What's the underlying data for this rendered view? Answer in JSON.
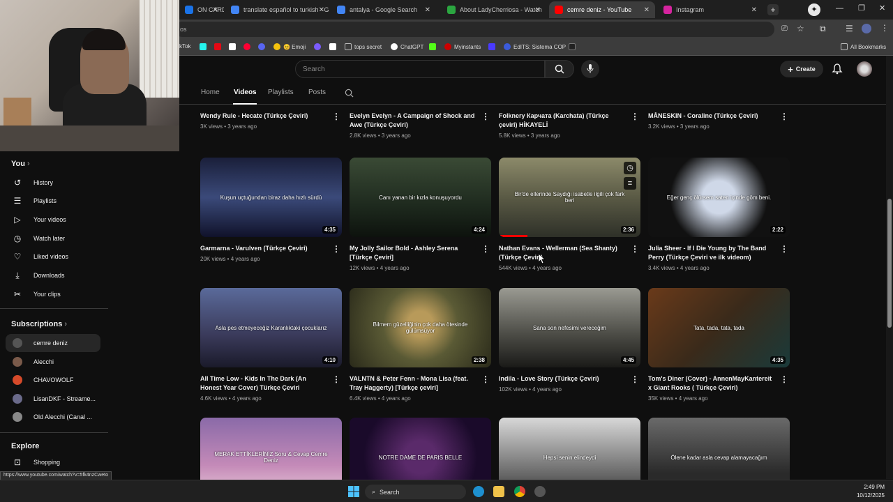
{
  "browser": {
    "tabs": [
      {
        "label": "ON CARD",
        "color": "#1a73e8"
      },
      {
        "label": "translate español to turkish - G",
        "color": "#4285f4"
      },
      {
        "label": "antalya - Google Search",
        "color": "#4285f4"
      },
      {
        "label": "About LadyCherriosa - Watch",
        "color": "#2ba640"
      },
      {
        "label": "cemre deniz - YouTube",
        "color": "#ff0000"
      },
      {
        "label": "Instagram",
        "color": "#d6249f"
      }
    ],
    "omnibox_text": "os",
    "bookmarks": [
      {
        "label": "kTok",
        "color": "#25f4ee"
      },
      {
        "label": "",
        "color": "#e50914"
      },
      {
        "label": "",
        "color": "#ffffff"
      },
      {
        "label": "",
        "color": "#ff0033"
      },
      {
        "label": "",
        "color": "#5865f2"
      },
      {
        "label": "😊 Emoji",
        "color": "#f4c20d"
      },
      {
        "label": "",
        "color": "#7b5cff"
      },
      {
        "label": "",
        "color": "#ffffff"
      },
      {
        "label": "tops secret",
        "color": "#bbbbbb"
      },
      {
        "label": "ChatGPT",
        "color": "#ffffff"
      },
      {
        "label": "",
        "color": "#53fc18"
      },
      {
        "label": "Myinstants",
        "color": "#cc0000"
      },
      {
        "label": "",
        "color": "#4a3aff"
      },
      {
        "label": "EdITS: Sistema COP",
        "color": "#3b5bdb"
      },
      {
        "label": "",
        "color": "#222222"
      }
    ],
    "all_bookmarks": "All Bookmarks",
    "status_url": "https://www.youtube.com/watch?v=5fk4nzCweto"
  },
  "header": {
    "search_placeholder": "Search",
    "create_label": "Create"
  },
  "channel_tabs": [
    "Home",
    "Videos",
    "Playlists",
    "Posts"
  ],
  "sidebar": {
    "you_label": "You",
    "you_items": [
      {
        "label": "History",
        "icon": "history-icon",
        "glyph": "↺"
      },
      {
        "label": "Playlists",
        "icon": "playlists-icon",
        "glyph": "☰"
      },
      {
        "label": "Your videos",
        "icon": "your-videos-icon",
        "glyph": "▶"
      },
      {
        "label": "Watch later",
        "icon": "watch-later-icon",
        "glyph": "◷"
      },
      {
        "label": "Liked videos",
        "icon": "thumbs-up-icon",
        "glyph": "👍"
      },
      {
        "label": "Downloads",
        "icon": "download-icon",
        "glyph": "⤓"
      },
      {
        "label": "Your clips",
        "icon": "scissors-icon",
        "glyph": "✂"
      }
    ],
    "subs_label": "Subscriptions",
    "subscriptions": [
      {
        "label": "cemre deniz",
        "color": "#555555"
      },
      {
        "label": "Alecchi",
        "color": "#7a5a4a"
      },
      {
        "label": "CHAVOWOLF",
        "color": "#d64a2a"
      },
      {
        "label": "LisanDKF - Streame...",
        "color": "#6a6a8a"
      },
      {
        "label": "Old Alecchi (Canal ...",
        "color": "#888888"
      }
    ],
    "explore_label": "Explore",
    "explore_items": [
      {
        "label": "Shopping",
        "icon": "shopping-bag-icon",
        "glyph": "🛍"
      }
    ]
  },
  "videos": [
    {
      "title": "Wendy Rule - Hecate (Türkçe Çeviri)",
      "meta": "3K views • 3 years ago",
      "duration": "",
      "overlay": "",
      "bg": "#222"
    },
    {
      "title": "Evelyn Evelyn - A Campaign of Shock and Awe (Türkçe Çeviri)",
      "meta": "2.8K views • 3 years ago",
      "duration": "",
      "overlay": "",
      "bg": "#222"
    },
    {
      "title": "Folknery Карчата (Karchata) (Türkçe çeviri) HİKAYELİ",
      "meta": "5.8K views • 3 years ago",
      "duration": "",
      "overlay": "",
      "bg": "#222"
    },
    {
      "title": "MÅNESKIN - Coraline (Türkçe Çeviri)",
      "meta": "3.2K views • 3 years ago",
      "duration": "",
      "overlay": "",
      "bg": "#222"
    },
    {
      "title": "Garmarna - Varulven (Türkçe Çeviri)",
      "meta": "20K views • 4 years ago",
      "duration": "4:35",
      "overlay": "Kuşun uçtuğundan biraz daha hızlı sürdü",
      "bg": "linear-gradient(180deg,#1a1f3a,#3b4a7a 50%,#10122a)"
    },
    {
      "title": "My Jolly Sailor Bold - Ashley Serena [Türkçe Çeviri]",
      "meta": "12K views • 4 years ago",
      "duration": "4:24",
      "overlay": "Canı yanan bir kızla konuşuyordu",
      "bg": "linear-gradient(180deg,#3a4a35,#1e2a1e 60%,#0d120d)"
    },
    {
      "title": "Nathan Evans - Wellerman (Sea Shanty) (Türkçe Çeviri)",
      "meta": "544K views • 4 years ago",
      "duration": "2:36",
      "overlay": "Bir'de ellerinde Saydığı isabetle ilgili çok fark beri",
      "bg": "linear-gradient(180deg,#8c8a6a,#5a5a45 50%,#2e3028)"
    },
    {
      "title": "Julia Sheer - If I Die Young by The Band Perry (Türkçe Çeviri ve ilk videom)",
      "meta": "3.4K views • 4 years ago",
      "duration": "2:22",
      "overlay": "Eğer genç ölürsem saten içinde göm beni.",
      "bg": "radial-gradient(circle,#cfd8e8 20%,#111 60%)"
    },
    {
      "title": "All Time Low - Kids In The Dark (An Honest Year Cover) Türkçe Çeviri",
      "meta": "4.6K views • 4 years ago",
      "duration": "4:10",
      "overlay": "Asla pes etmeyeceğiz Karanlıktaki çocuklarız",
      "bg": "linear-gradient(180deg,#5a6a9a,#3a3a5a 60%,#1a1a2a)"
    },
    {
      "title": "VALNTN & Peter Fenn - Mona Lisa (feat. Tray Haggerty) [Türkçe çeviri]",
      "meta": "6.4K views • 4 years ago",
      "duration": "2:38",
      "overlay": "Bilmem güzelliğinin çok daha ötesinde gülümsüyor",
      "bg": "radial-gradient(circle at 50% 45%,#b89a5a 15%,#5a5a35 45%,#2a2a1a)"
    },
    {
      "title": "Indila - Love Story (Türkçe Çeviri)",
      "meta": "102K views • 4 years ago",
      "duration": "4:45",
      "overlay": "Sana son nefesimi vereceğim",
      "bg": "linear-gradient(180deg,#9a9a92,#4a4a44 60%,#1a1a18)"
    },
    {
      "title": "Tom's Diner (Cover) - AnnenMayKantereit x Giant Rooks ( Türkçe Çeviri)",
      "meta": "35K views • 4 years ago",
      "duration": "4:35",
      "overlay": "Tata, tada, tata, tada",
      "bg": "linear-gradient(135deg,#6a3a1a,#3a2a1a 50%,#1a3a3a)"
    },
    {
      "title": "",
      "meta": "",
      "duration": "",
      "overlay": "MERAK ETTİKLERİNİZ Soru & Cevap Cemre Deniz",
      "bg": "linear-gradient(180deg,#8a6aa8,#c48ab8 60%,#e8c8d8)"
    },
    {
      "title": "",
      "meta": "",
      "duration": "",
      "overlay": "NOTRE DAME DE PARIS BELLE",
      "bg": "radial-gradient(circle,#5a2a6a 20%,#1a0a2a 70%)"
    },
    {
      "title": "",
      "meta": "",
      "duration": "",
      "overlay": "Hepsi senin elindeydi",
      "bg": "linear-gradient(180deg,#d8d8d8,#7a7a7a 60%,#3a3a3a)"
    },
    {
      "title": "",
      "meta": "",
      "duration": "",
      "overlay": "Ölene kadar asla cevap alamayacağım",
      "bg": "linear-gradient(180deg,#6a6a6a,#2a2a2a 70%)"
    }
  ],
  "taskbar": {
    "search_label": "Search",
    "time": "2:49 PM",
    "date": "10/12/2025"
  }
}
